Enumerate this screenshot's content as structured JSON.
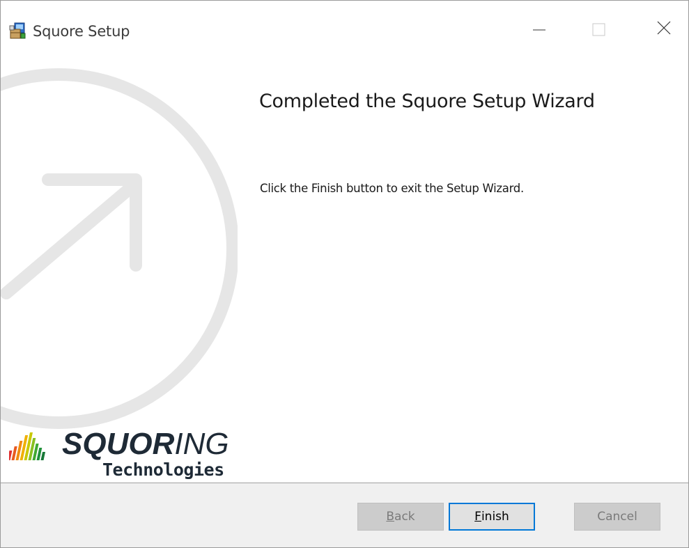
{
  "window": {
    "title": "Squore Setup",
    "icon": "installer-package-icon"
  },
  "caption_buttons": {
    "minimize": "minimize-icon",
    "maximize": "maximize-icon",
    "close": "close-icon"
  },
  "content": {
    "heading": "Completed the Squore Setup Wizard",
    "message": "Click the Finish button to exit the Setup Wizard."
  },
  "logo": {
    "word_strong": "SQUOR",
    "word_light": "ING",
    "subtitle": "Technologies"
  },
  "buttons": {
    "back": {
      "accel": "B",
      "rest": "ack",
      "enabled": false
    },
    "finish": {
      "accel": "F",
      "rest": "inish",
      "enabled": true,
      "default": true
    },
    "cancel": {
      "label": "Cancel",
      "enabled": false
    }
  },
  "colors": {
    "accent": "#0078d7",
    "footer_bg": "#f0f0f0",
    "art_stroke": "#e6e6e6"
  }
}
